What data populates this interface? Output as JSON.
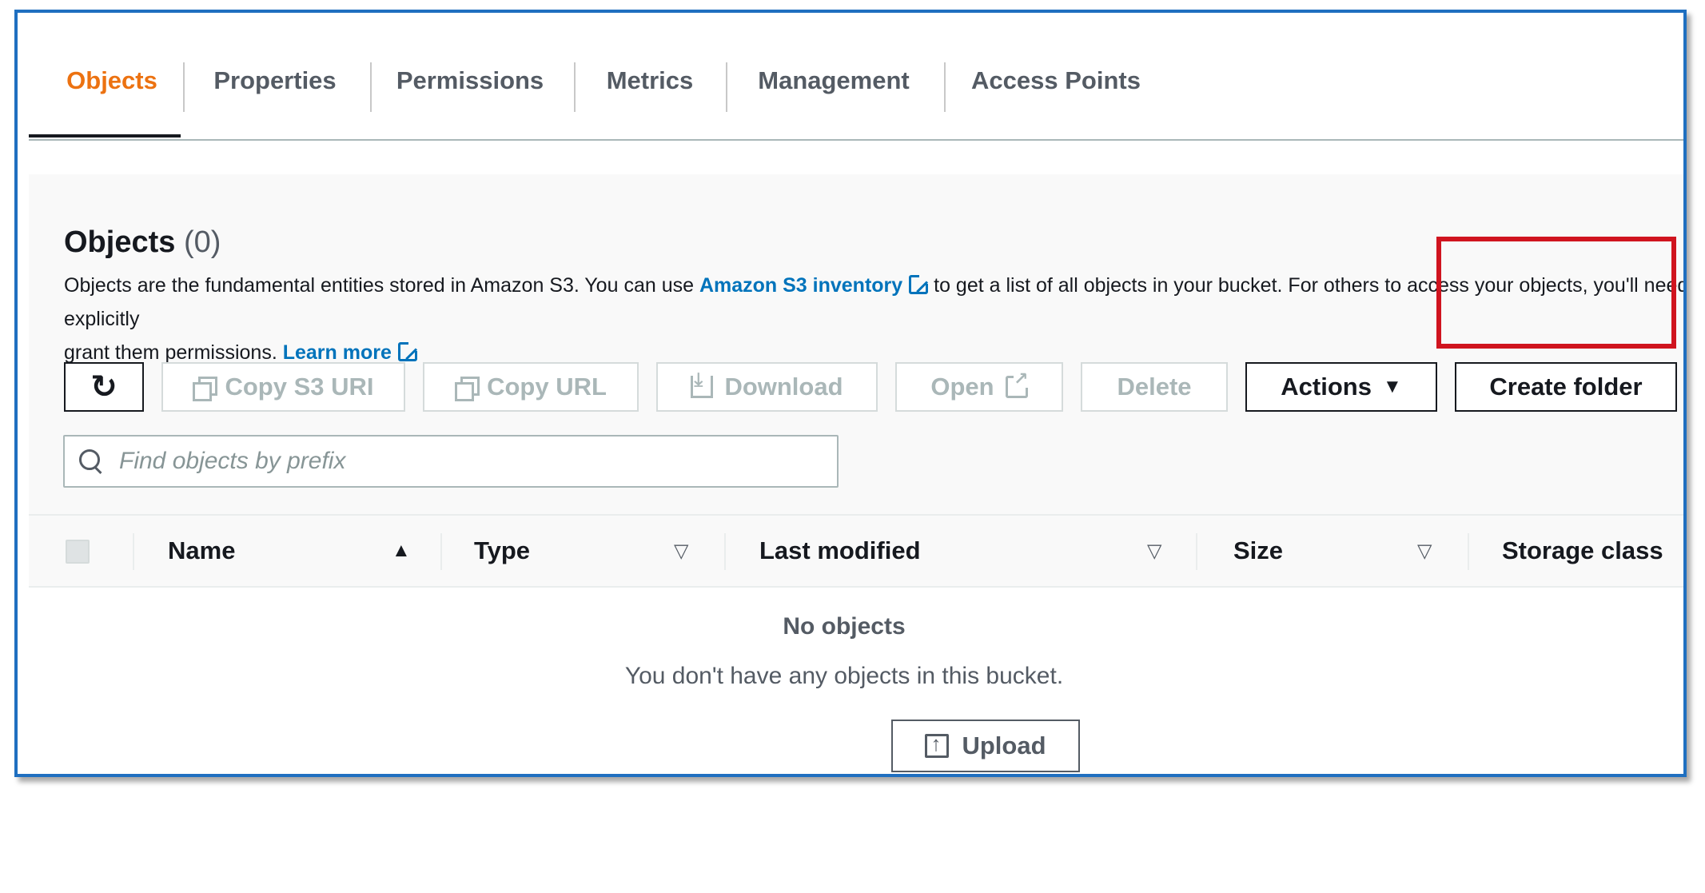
{
  "tabs": [
    {
      "label": "Objects"
    },
    {
      "label": "Properties"
    },
    {
      "label": "Permissions"
    },
    {
      "label": "Metrics"
    },
    {
      "label": "Management"
    },
    {
      "label": "Access Points"
    }
  ],
  "panel": {
    "title": "Objects",
    "count": "(0)",
    "desc_part1": "Objects are the fundamental entities stored in Amazon S3. You can use ",
    "inventory_link": "Amazon S3 inventory",
    "desc_part2": " to get a list of all objects in your bucket. For others to access your objects, you'll need to explicitly",
    "desc_part3": "grant them permissions. ",
    "learn_more": "Learn more"
  },
  "toolbar": {
    "copy_s3_uri": "Copy S3 URI",
    "copy_url": "Copy URL",
    "download": "Download",
    "open": "Open",
    "delete": "Delete",
    "actions": "Actions",
    "create_folder": "Create folder"
  },
  "search": {
    "placeholder": "Find objects by prefix"
  },
  "table": {
    "columns": [
      "Name",
      "Type",
      "Last modified",
      "Size",
      "Storage class"
    ],
    "empty_title": "No objects",
    "empty_text": "You don't have any objects in this bucket.",
    "upload": "Upload"
  },
  "colors": {
    "accent": "#ec7211",
    "link": "#0073bb",
    "highlight": "#d0141f",
    "frame": "#1f6fc0"
  }
}
